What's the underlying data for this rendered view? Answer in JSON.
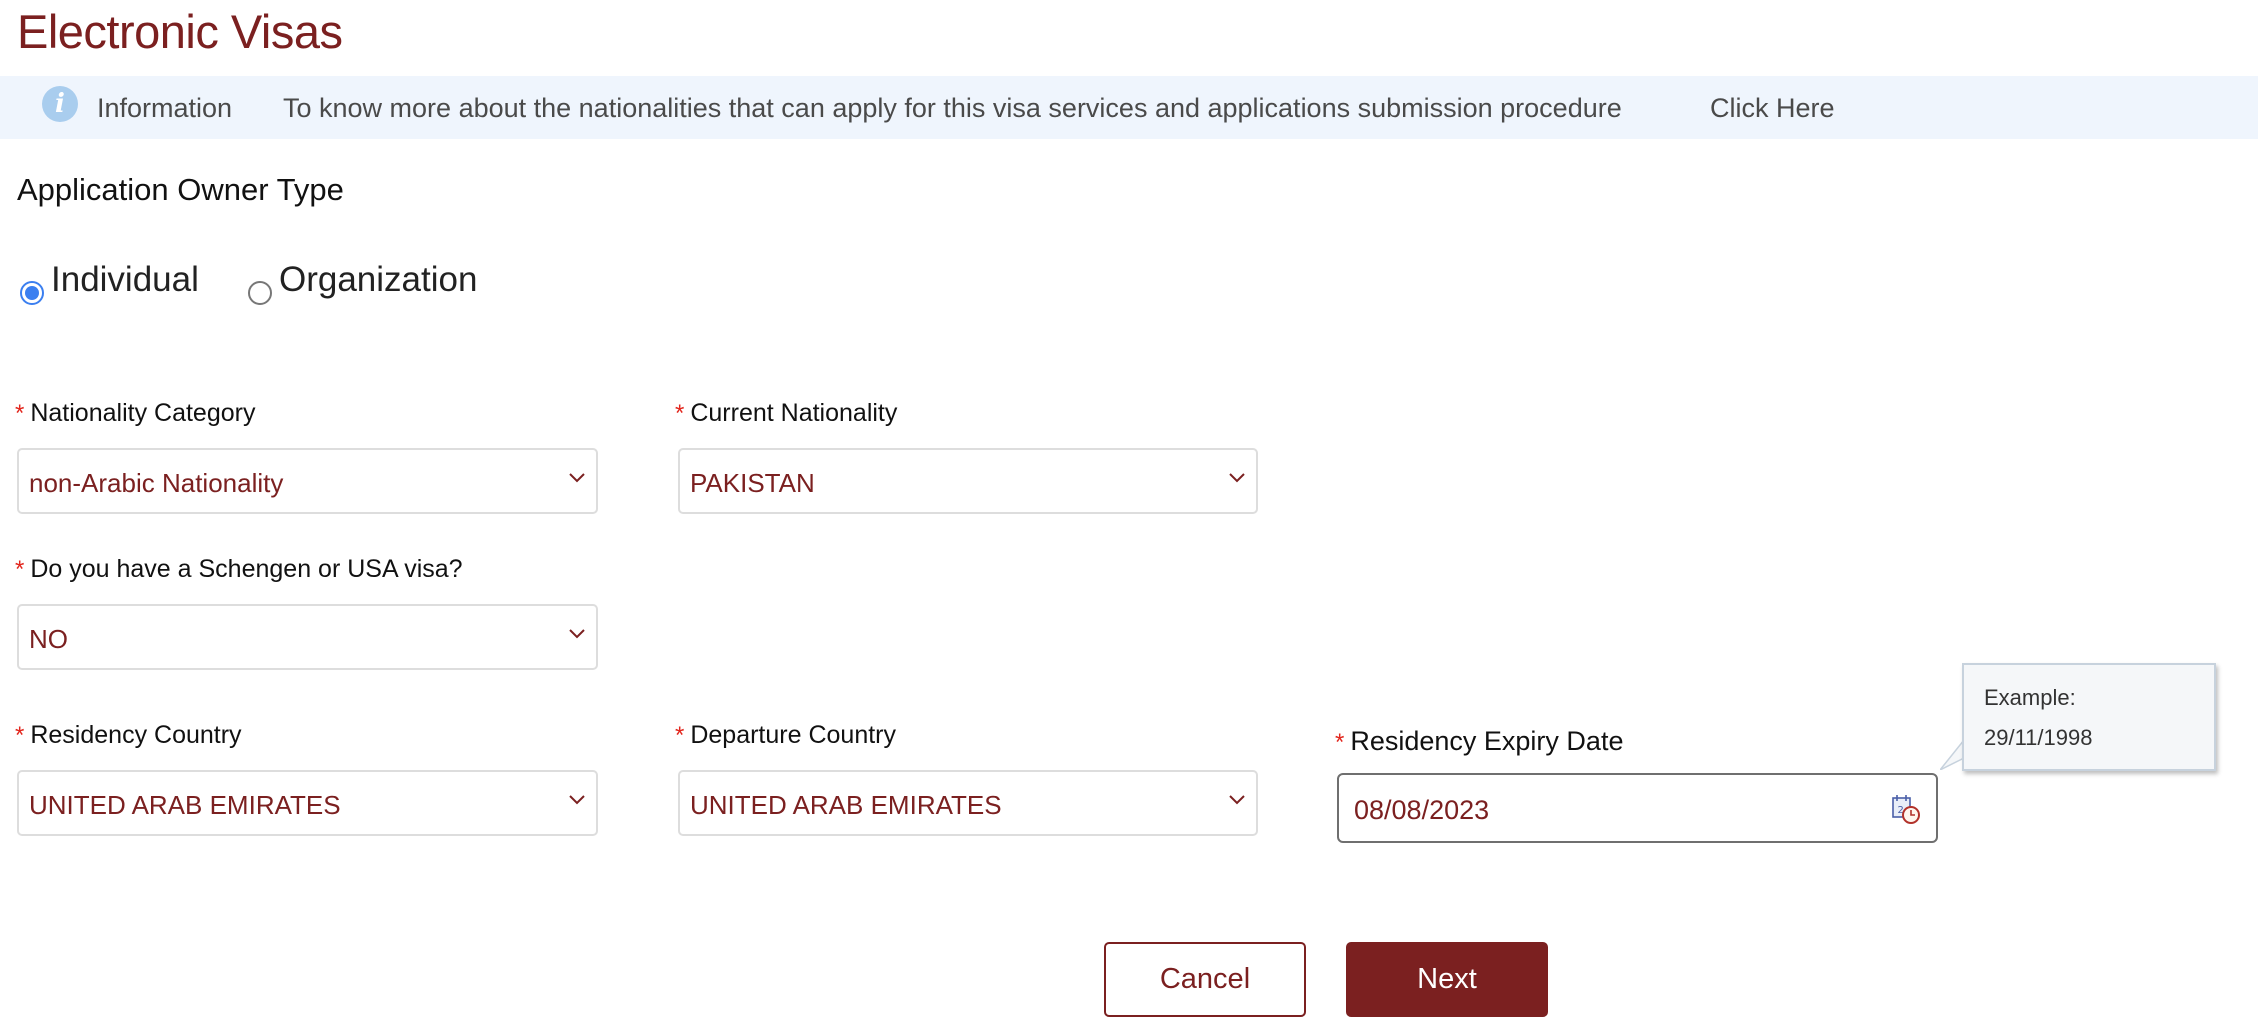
{
  "page": {
    "title": "Electronic Visas"
  },
  "info_bar": {
    "icon": "info-icon",
    "label": "Information",
    "text": "To know more about the nationalities that can apply for this visa services and applications submission procedure",
    "link": "Click Here"
  },
  "owner_type": {
    "title": "Application Owner Type",
    "options": [
      {
        "label": "Individual",
        "selected": true
      },
      {
        "label": "Organization",
        "selected": false
      }
    ]
  },
  "fields": {
    "nationality_category": {
      "label": "Nationality Category",
      "required_mark": "*",
      "value": "non-Arabic Nationality"
    },
    "current_nationality": {
      "label": "Current Nationality",
      "required_mark": "*",
      "value": "PAKISTAN"
    },
    "schengen_usa_visa": {
      "label": "Do you have a Schengen or USA visa?",
      "required_mark": "*",
      "value": "NO"
    },
    "residency_country": {
      "label": "Residency Country",
      "required_mark": "*",
      "value": "UNITED ARAB EMIRATES"
    },
    "departure_country": {
      "label": "Departure Country",
      "required_mark": "*",
      "value": "UNITED ARAB EMIRATES"
    },
    "residency_expiry_date": {
      "label": "Residency Expiry Date",
      "required_mark": "*",
      "value": "08/08/2023",
      "icon": "calendar-clock-icon"
    }
  },
  "tooltip": {
    "line1": "Example:",
    "line2": "29/11/1998"
  },
  "buttons": {
    "cancel": "Cancel",
    "next": "Next"
  },
  "colors": {
    "brand": "#7b2020",
    "required": "#e2261d",
    "info_bg": "#eff5fd",
    "radio_selected": "#3b7ff0"
  }
}
